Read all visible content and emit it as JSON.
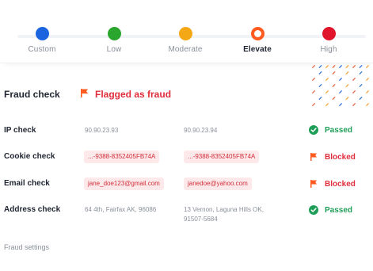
{
  "risk_levels": [
    {
      "label": "Custom",
      "color": "#1a64e0",
      "selected": false
    },
    {
      "label": "Low",
      "color": "#2aa52e",
      "selected": false
    },
    {
      "label": "Moderate",
      "color": "#f5a815",
      "selected": false
    },
    {
      "label": "Elevate",
      "color": "#ff5a1f",
      "selected": true
    },
    {
      "label": "High",
      "color": "#e0142b",
      "selected": false
    }
  ],
  "fraud_check": {
    "title": "Fraud check",
    "status": "Flagged as fraud",
    "status_color": "#e02d3c",
    "icon": "flag-icon"
  },
  "checks": [
    {
      "label": "IP check",
      "value_a": "90.90.23.93",
      "value_b": "90.90.23.94",
      "highlighted": false,
      "status": "Passed",
      "result": "pass"
    },
    {
      "label": "Cookie check",
      "value_a": "...-9388-8352405FB74A",
      "value_b": "...-9388-8352405FB74A",
      "highlighted": true,
      "status": "Blocked",
      "result": "block"
    },
    {
      "label": "Email check",
      "value_a": "jane_doe123@gmail.com",
      "value_b": "janedoe@yahoo.com",
      "highlighted": true,
      "status": "Blocked",
      "result": "block"
    },
    {
      "label": "Address check",
      "value_a": "64 4th, Fairfax AK, 96086",
      "value_b_line1": "13 Vernon, Laguna Hills OK,",
      "value_b_line2": "91507-5684",
      "highlighted": false,
      "status": "Passed",
      "result": "pass"
    }
  ],
  "colors": {
    "passed": "#1e9e58",
    "blocked": "#e02d3c",
    "chip_bg": "#fde8ea"
  },
  "footer": {
    "settings_link": "Fraud settings"
  }
}
